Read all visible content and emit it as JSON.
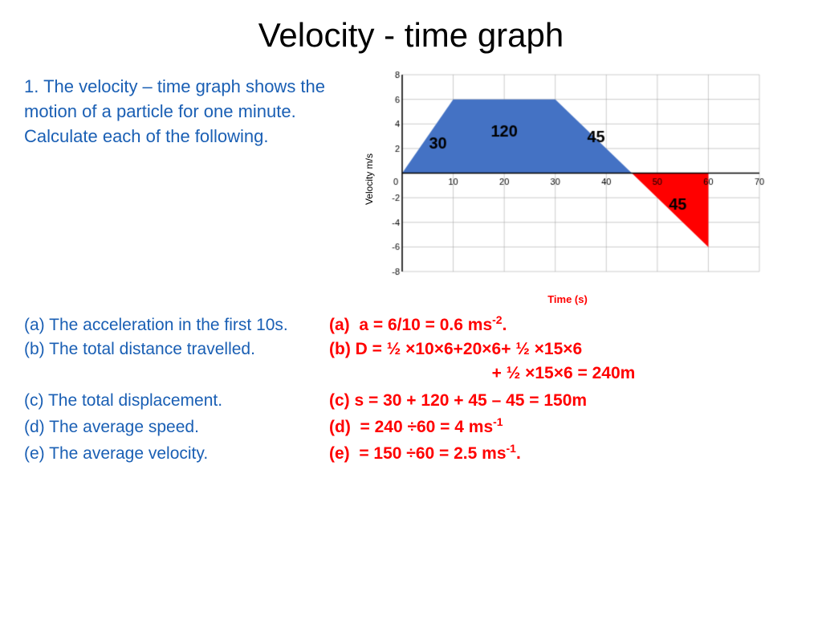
{
  "title": "Velocity -  time graph",
  "description": "1. The velocity – time graph shows the motion of a particle for one minute. Calculate each of the following.",
  "graph": {
    "yAxisLabel": "Velocity m/s",
    "xAxisLabel": "Time (s)",
    "yMax": 8,
    "yMin": -8,
    "xMax": 70,
    "xMin": 0,
    "labels": {
      "blue30": "30",
      "blue120": "120",
      "blue45": "45",
      "red45": "45"
    }
  },
  "qa": [
    {
      "question": "(a) The acceleration in the first 10s.",
      "answer": "(a)  a = 6/10 = 0.6 ms",
      "answerSup": "-2",
      "answerEnd": "."
    },
    {
      "question": "(b) The total distance travelled.",
      "answer": "(b) D = ½ ×10×6+20×6+ ½ ×15×6",
      "answer2": "+ ½ ×15×6 = 240m"
    },
    {
      "question": "(c) The total displacement.",
      "answer": "(c) s = 30 + 120 + 45 – 45 = 150m"
    },
    {
      "question": "(d) The average speed.",
      "answer": "(d)  = 240 ÷60 = 4 ms",
      "answerSup": "-1"
    },
    {
      "question": "(e) The average velocity.",
      "answer": "(e)  = 150 ÷60 = 2.5 ms",
      "answerSup": "-1",
      "answerEnd": "."
    }
  ]
}
